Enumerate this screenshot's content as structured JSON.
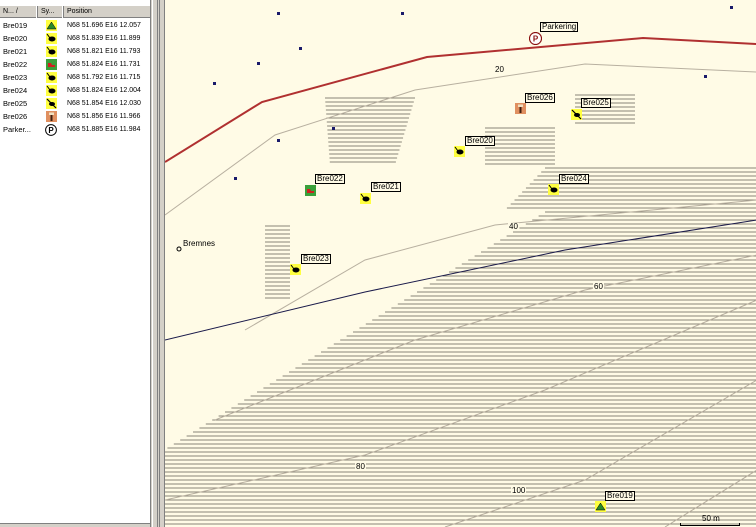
{
  "list": {
    "columns": {
      "name": "N...  /",
      "symbol": "Sy...",
      "position": "Position"
    },
    "rows": [
      {
        "name": "Bre019",
        "symbol": "tent-icon",
        "position": "N68 51.696 E16 12.057"
      },
      {
        "name": "Bre020",
        "symbol": "fishing-icon",
        "position": "N68 51.839 E16 11.899"
      },
      {
        "name": "Bre021",
        "symbol": "fishing-icon",
        "position": "N68 51.821 E16 11.793"
      },
      {
        "name": "Bre022",
        "symbol": "shoe-icon",
        "position": "N68 51.824 E16 11.731"
      },
      {
        "name": "Bre023",
        "symbol": "fishing-icon",
        "position": "N68 51.792 E16 11.715"
      },
      {
        "name": "Bre024",
        "symbol": "fishing-icon",
        "position": "N68 51.824 E16 12.004"
      },
      {
        "name": "Bre025",
        "symbol": "no-fishing-icon",
        "position": "N68 51.854 E16 12.030"
      },
      {
        "name": "Bre026",
        "symbol": "info-sign-icon",
        "position": "N68 51.856 E16 11.966"
      },
      {
        "name": "Parker...",
        "symbol": "parking-icon",
        "position": "N68 51.885 E16 11.984"
      }
    ]
  },
  "map": {
    "waypoints": [
      {
        "label": "Bre019",
        "symbol": "tent-icon"
      },
      {
        "label": "Bre020",
        "symbol": "fishing-icon"
      },
      {
        "label": "Bre021",
        "symbol": "fishing-icon"
      },
      {
        "label": "Bre022",
        "symbol": "shoe-icon"
      },
      {
        "label": "Bre023",
        "symbol": "fishing-icon"
      },
      {
        "label": "Bre024",
        "symbol": "fishing-icon"
      },
      {
        "label": "Bre025",
        "symbol": "no-fishing-icon"
      },
      {
        "label": "Bre026",
        "symbol": "info-sign-icon"
      },
      {
        "label": "Parkering",
        "symbol": "parking-icon"
      }
    ],
    "place_name": "Bremnes",
    "contours": [
      "20",
      "40",
      "60",
      "80",
      "100"
    ],
    "scale_label": "50 m",
    "colors": {
      "map_bg": "#fffbe6",
      "road": "#b03030",
      "contour": "#b8b0a0",
      "water_hatch": "#8a8478",
      "path": "#1a1a4a"
    }
  }
}
